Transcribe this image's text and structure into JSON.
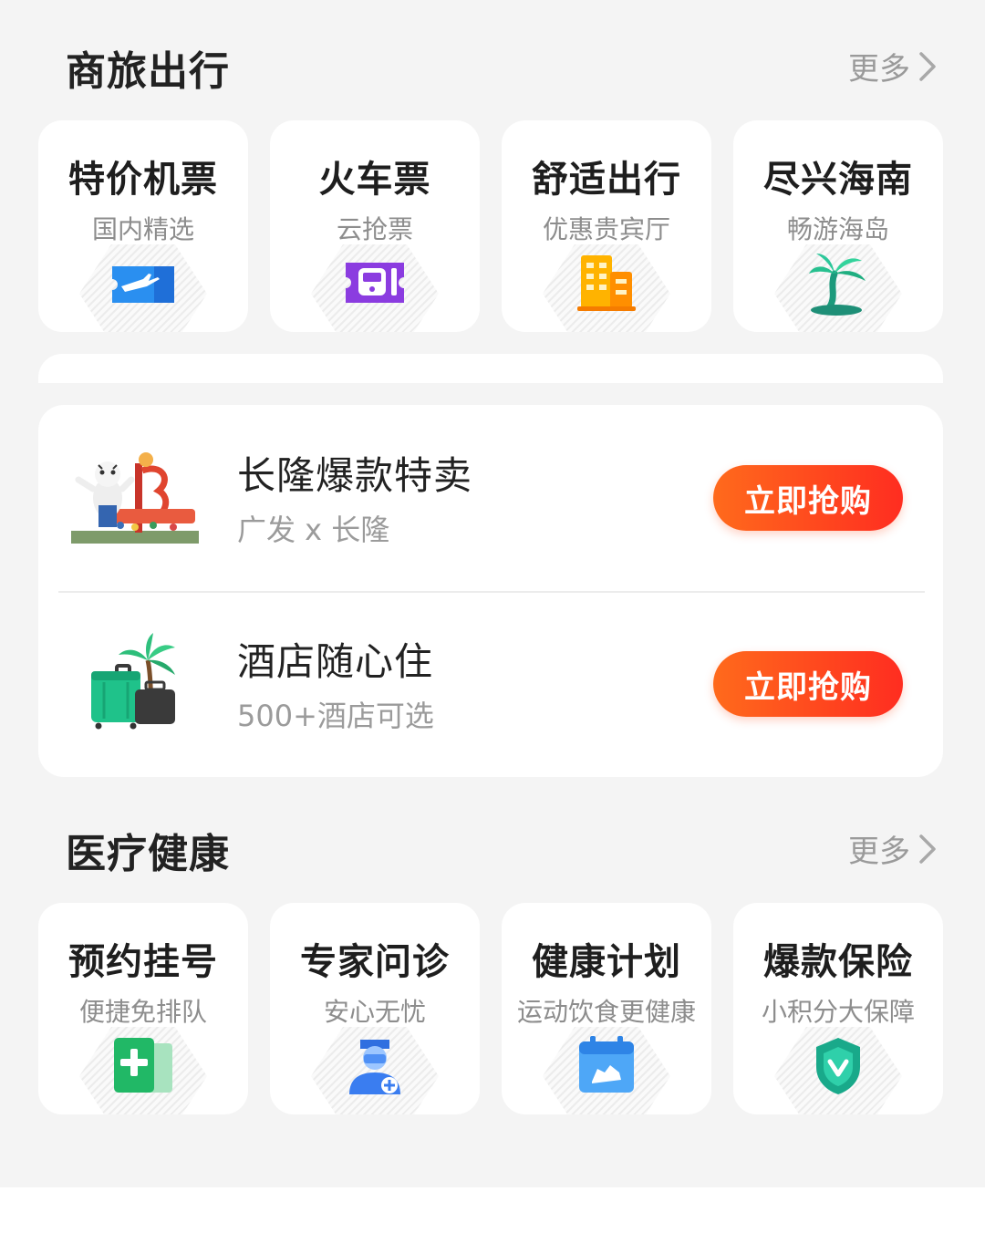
{
  "business_travel": {
    "title": "商旅出行",
    "more": "更多",
    "cards": [
      {
        "title": "特价机票",
        "subtitle": "国内精选",
        "icon": "plane-ticket-icon"
      },
      {
        "title": "火车票",
        "subtitle": "云抢票",
        "icon": "train-ticket-icon"
      },
      {
        "title": "舒适出行",
        "subtitle": "优惠贵宾厅",
        "icon": "building-icon"
      },
      {
        "title": "尽兴海南",
        "subtitle": "畅游海岛",
        "icon": "palm-island-icon"
      }
    ]
  },
  "promos": [
    {
      "title": "长隆爆款特卖",
      "subtitle": "广发 x 长隆",
      "button": "立即抢购",
      "image": "chimelong-park-image"
    },
    {
      "title": "酒店随心住",
      "subtitle": "500+酒店可选",
      "button": "立即抢购",
      "image": "luggage-palm-image"
    }
  ],
  "medical_health": {
    "title": "医疗健康",
    "more": "更多",
    "cards": [
      {
        "title": "预约挂号",
        "subtitle": "便捷免排队",
        "icon": "medical-plus-icon"
      },
      {
        "title": "专家问诊",
        "subtitle": "安心无忧",
        "icon": "doctor-icon"
      },
      {
        "title": "健康计划",
        "subtitle": "运动饮食更健康",
        "icon": "calendar-shoe-icon"
      },
      {
        "title": "爆款保险",
        "subtitle": "小积分大保障",
        "icon": "shield-icon"
      }
    ]
  },
  "colors": {
    "accent": "#ff4a1e",
    "background": "#f4f4f4"
  }
}
